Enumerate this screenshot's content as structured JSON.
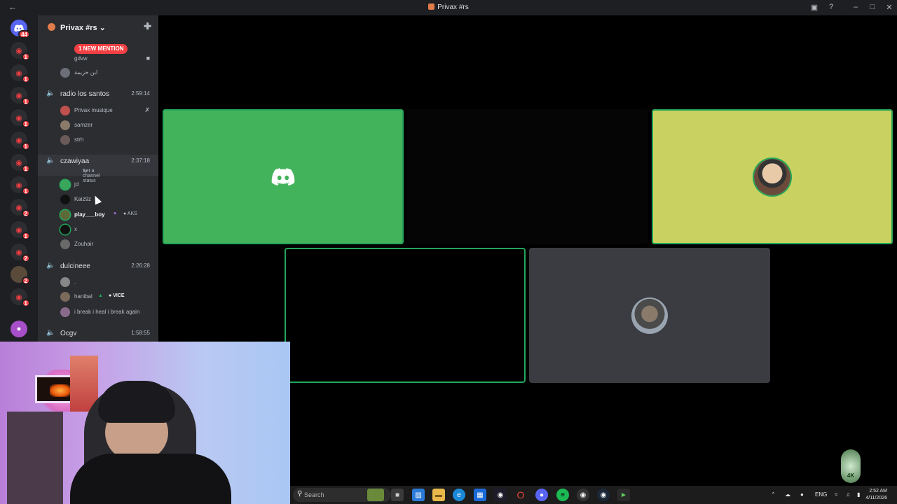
{
  "window": {
    "title": "Privax #rs"
  },
  "guilds": {
    "home_badge": "44",
    "servers": [
      {
        "badge": "1"
      },
      {
        "badge": "1"
      },
      {
        "badge": "1"
      },
      {
        "badge": "1"
      },
      {
        "badge": "1"
      },
      {
        "badge": "1"
      },
      {
        "badge": "1"
      },
      {
        "badge": "2"
      },
      {
        "badge": "1"
      },
      {
        "badge": "2"
      },
      {
        "badge": "2"
      },
      {
        "badge": "1"
      }
    ]
  },
  "sidebar": {
    "server_name": "Privax #rs",
    "mention_label": "1 NEW MENTION",
    "top_users": [
      {
        "name": "gdvw"
      },
      {
        "name": "ابن خزيمة"
      }
    ],
    "channels": [
      {
        "name": "radio los santos",
        "time": "2:59:14",
        "users": [
          {
            "name": "Privax musique"
          },
          {
            "name": "samzer"
          },
          {
            "name": "strh"
          }
        ]
      },
      {
        "name": "czawiyaa",
        "time": "2:37:18",
        "status": "Set a channel status",
        "users": [
          {
            "name": "jd"
          },
          {
            "name": "Kaiz9z"
          },
          {
            "name": "play___boy",
            "tag": "AKS"
          },
          {
            "name": "x"
          },
          {
            "name": "Zouhair"
          }
        ]
      },
      {
        "name": "dulcineee",
        "time": "2:26:28",
        "users": [
          {
            "name": "."
          },
          {
            "name": "hanibal",
            "tag": "VICE"
          },
          {
            "name": "i break i heal i break again"
          }
        ]
      },
      {
        "name": "Ocgv",
        "time": "1:58:55"
      }
    ]
  },
  "taskbar": {
    "search_placeholder": "Search",
    "lang": "ENG",
    "time": "2:52 AM",
    "date": "4/11/2026"
  },
  "colors": {
    "tile_green": "#43b35b",
    "tile_yellow": "#c9d160",
    "tile_gray": "#3a3c42",
    "speaking": "#23a55a",
    "mention_red": "#f23f43"
  }
}
